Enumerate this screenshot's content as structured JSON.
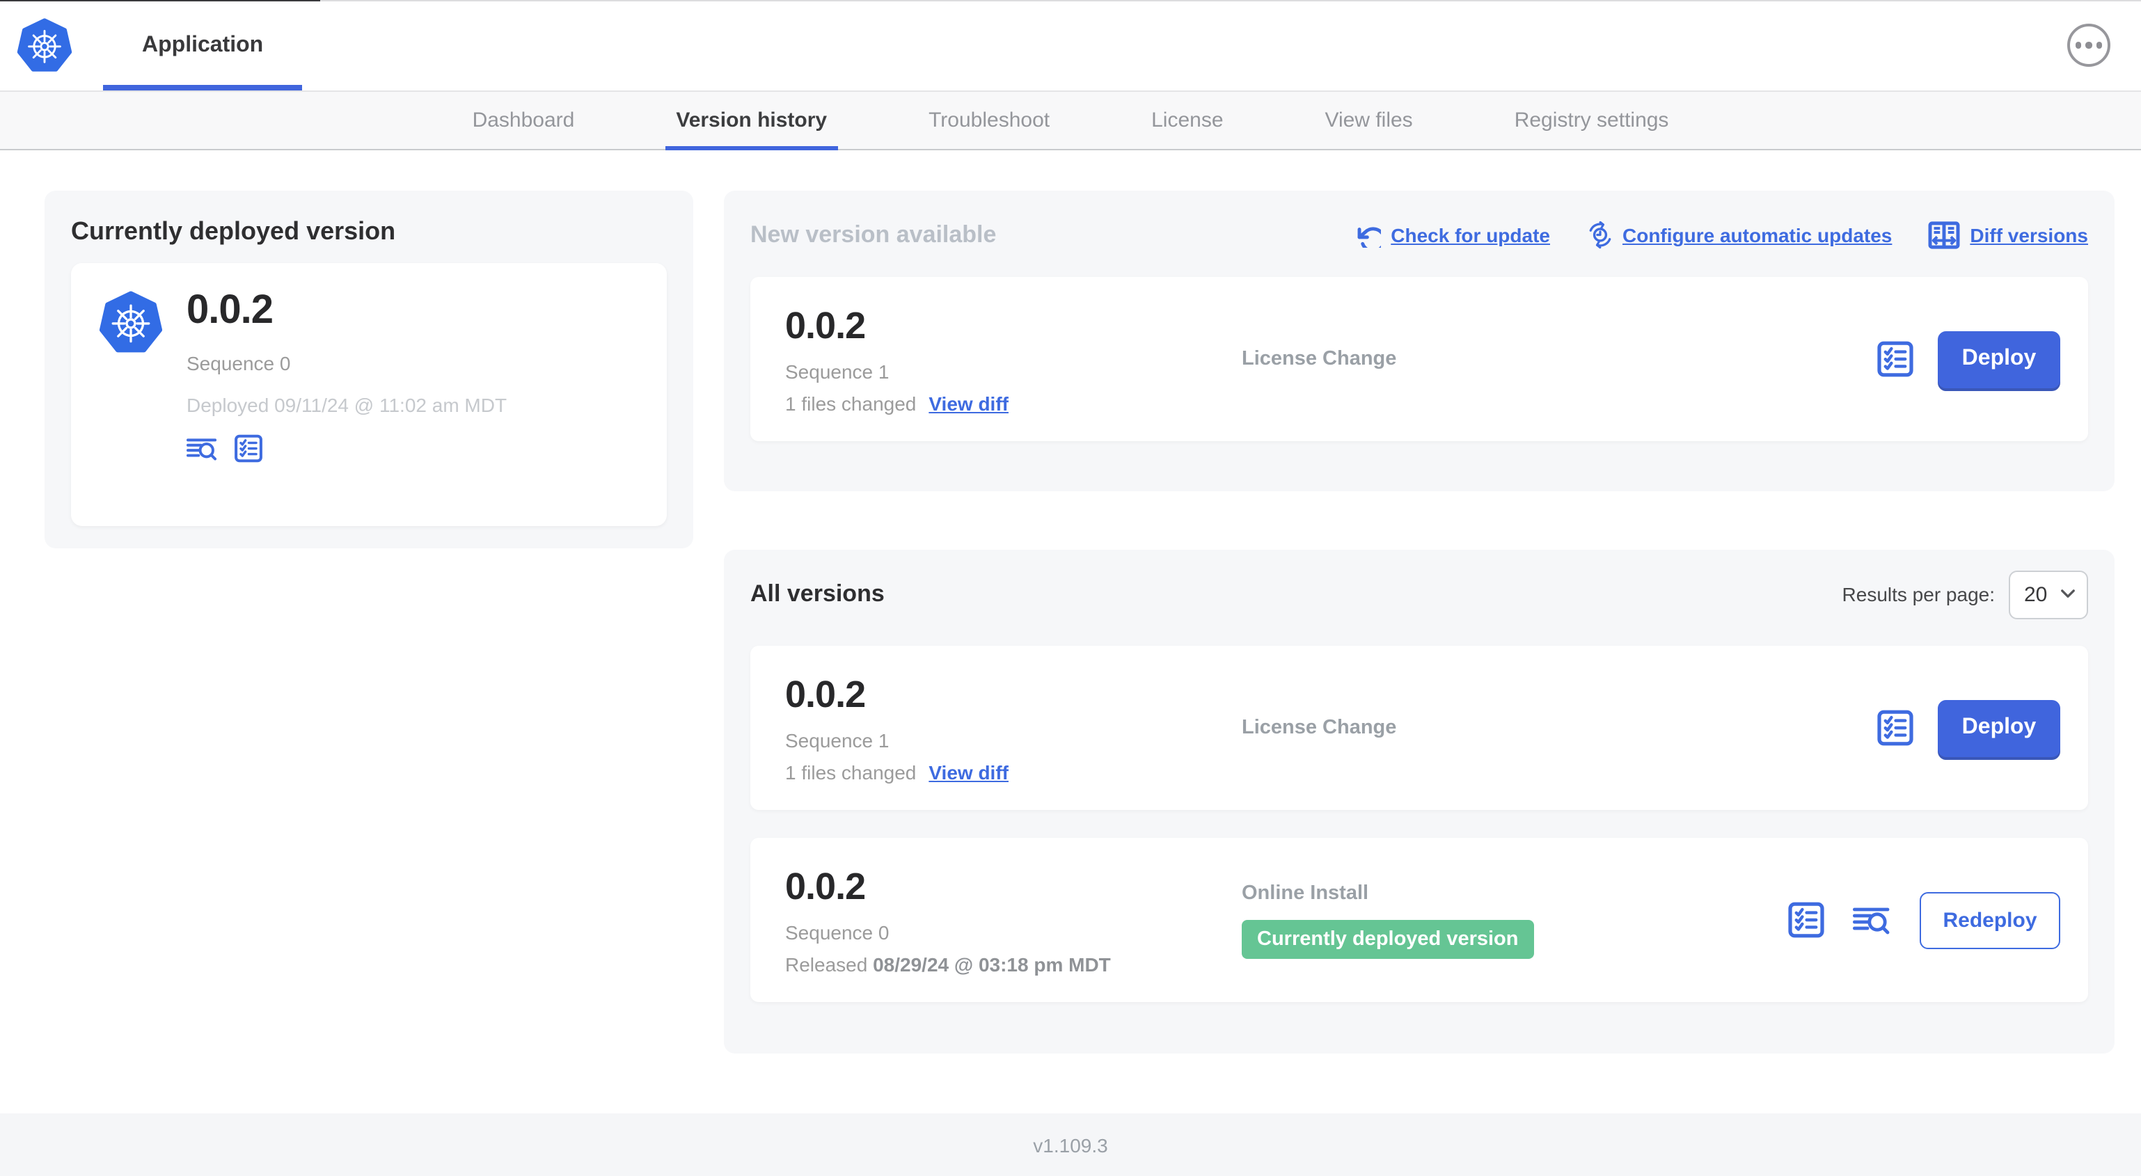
{
  "colors": {
    "accent_blue": "#3e6be0",
    "button_blue": "#4065dd",
    "kubernetes_blue": "#326ce5",
    "success_green": "#65c594",
    "muted_text": "#9b9b9b"
  },
  "header": {
    "title": "Application"
  },
  "nav": {
    "active_tab": "Version history",
    "tabs": [
      {
        "label": "Dashboard"
      },
      {
        "label": "Version history"
      },
      {
        "label": "Troubleshoot"
      },
      {
        "label": "License"
      },
      {
        "label": "View files"
      },
      {
        "label": "Registry settings"
      }
    ]
  },
  "current": {
    "title": "Currently deployed version",
    "version": "0.0.2",
    "sequence": "Sequence 0",
    "deployed": "Deployed 09/11/24 @ 11:02 am MDT"
  },
  "newver": {
    "title": "New version available",
    "actions": [
      {
        "label": "Check for update"
      },
      {
        "label": "Configure automatic updates"
      },
      {
        "label": "Diff versions"
      }
    ],
    "row": {
      "version": "0.0.2",
      "sequence": "Sequence 1",
      "files_changed": "1 files changed",
      "view_diff": "View diff",
      "change_type": "License Change",
      "deploy_label": "Deploy"
    }
  },
  "allver": {
    "title": "All versions",
    "results_label": "Results per page:",
    "per_page": "20",
    "rows": [
      {
        "version": "0.0.2",
        "sequence": "Sequence 1",
        "files_changed": "1 files changed",
        "view_diff": "View diff",
        "change_type": "License Change",
        "button": "Deploy"
      },
      {
        "version": "0.0.2",
        "sequence": "Sequence 0",
        "released_prefix": "Released ",
        "released_date": "08/29/24 @ 03:18 pm MDT",
        "change_type": "Online Install",
        "badge": "Currently deployed version",
        "button": "Redeploy"
      }
    ]
  },
  "footer": {
    "version": "v1.109.3"
  },
  "icons": {
    "header": [
      "kubernetes-logo",
      "ellipsis-icon"
    ],
    "deployed_card": [
      "view-logs-icon",
      "preflight-checks-icon"
    ],
    "update_links": [
      "refresh-icon",
      "auto-update-clock-icon",
      "diff-columns-icon"
    ],
    "row_actions": [
      "preflight-checks-icon",
      "view-logs-icon"
    ],
    "per_page": [
      "chevron-down-icon"
    ]
  }
}
